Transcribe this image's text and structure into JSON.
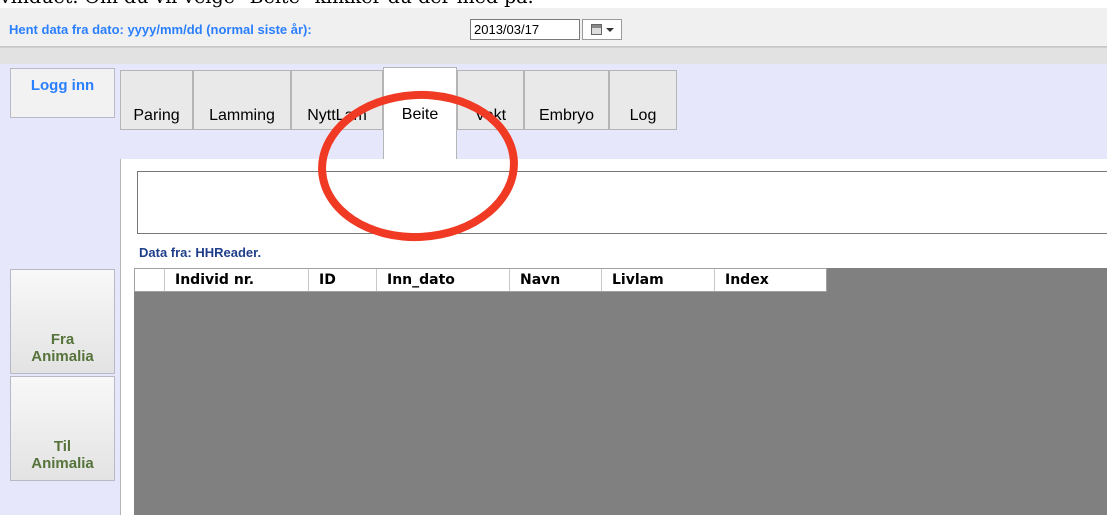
{
  "caption": "vinduet. Om du vil velge \"Beite\" klikker du der med på.",
  "topbar": {
    "date_label": "Hent data fra dato: yyyy/mm/dd (normal siste år):",
    "date_value": "2013/03/17",
    "date_picker_icon": "calendar-dropdown-icon"
  },
  "sidebar": {
    "login": "Logg inn",
    "from_animalia": "Fra\nAnimalia",
    "to_animalia": "Til\nAnimalia"
  },
  "tabs": [
    {
      "label": "Paring",
      "active": false
    },
    {
      "label": "Lamming",
      "active": false
    },
    {
      "label": "NyttLam",
      "active": false
    },
    {
      "label": "Beite",
      "active": true
    },
    {
      "label": "Vekt",
      "active": false
    },
    {
      "label": "Embryo",
      "active": false
    },
    {
      "label": "Log",
      "active": false
    }
  ],
  "panel": {
    "data_source": "Data fra: HHReader.",
    "columns": [
      "",
      "Individ nr.",
      "ID",
      "Inn_dato",
      "Navn",
      "Livlam",
      "Index"
    ]
  },
  "annotation": {
    "color": "#f03a24"
  }
}
